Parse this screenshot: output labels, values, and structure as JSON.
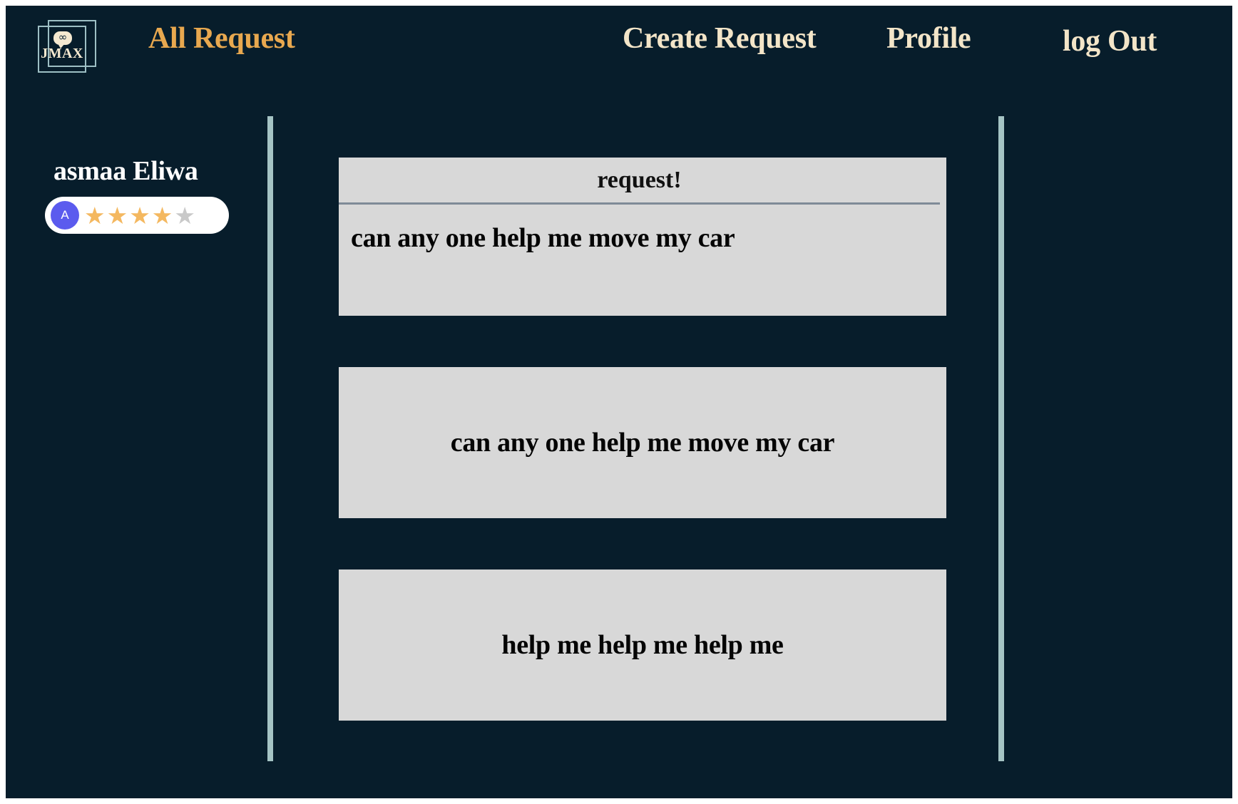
{
  "theme": {
    "background": "#071d2b",
    "accent_orange": "#e8a84f",
    "nav_text": "#f3e5c8",
    "rail": "#a5c4c4",
    "card_bg": "#d8d8d8",
    "star_on": "#f4b860",
    "star_off": "#c9c9c9",
    "avatar_bg": "#5b5bee"
  },
  "navbar": {
    "logo": {
      "wordmark": "JMAX",
      "bubble_glyph": "∞",
      "icon_name": "jmax-logo"
    },
    "links": [
      {
        "id": "all-request",
        "label": "All Request",
        "active": true
      },
      {
        "id": "create-request",
        "label": "Create Request",
        "active": false
      },
      {
        "id": "profile",
        "label": "Profile",
        "active": false
      },
      {
        "id": "log-out",
        "label": "log Out",
        "active": false
      }
    ]
  },
  "sidebar": {
    "user_name": "asmaa Eliwa",
    "avatar_initial": "A",
    "rating": {
      "value": 4,
      "max": 5,
      "glyph": "★"
    }
  },
  "feed": {
    "cards": [
      {
        "id": "card-1",
        "header": "request!",
        "has_header": true,
        "body": "can any one help me move my car",
        "align": "left"
      },
      {
        "id": "card-2",
        "header": "",
        "has_header": false,
        "body": "can any one help me move my car",
        "align": "center"
      },
      {
        "id": "card-3",
        "header": "",
        "has_header": false,
        "body": "help me help me help me",
        "align": "center"
      }
    ]
  }
}
